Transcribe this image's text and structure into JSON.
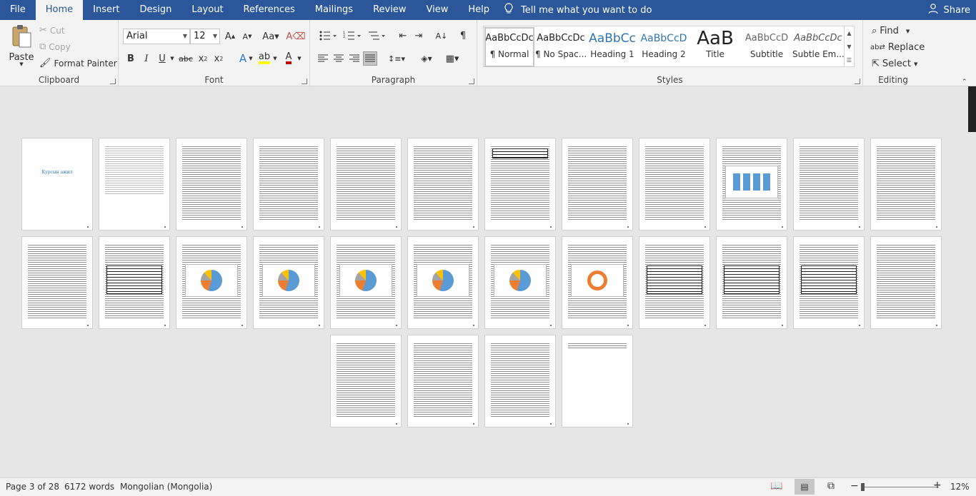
{
  "tabs": [
    "File",
    "Home",
    "Insert",
    "Design",
    "Layout",
    "References",
    "Mailings",
    "Review",
    "View",
    "Help"
  ],
  "tell_me": "Tell me what you want to do",
  "share": "Share",
  "clipboard": {
    "paste": "Paste",
    "cut": "Cut",
    "copy": "Copy",
    "format_painter": "Format Painter",
    "label": "Clipboard"
  },
  "font": {
    "name": "Arial",
    "size": "12",
    "label": "Font"
  },
  "paragraph": {
    "label": "Paragraph"
  },
  "styles": {
    "label": "Styles",
    "items": [
      {
        "preview": "AaBbCcDc",
        "name": "¶ Normal"
      },
      {
        "preview": "AaBbCcDc",
        "name": "¶ No Spac..."
      },
      {
        "preview": "AaBbCc",
        "name": "Heading 1"
      },
      {
        "preview": "AaBbCcD",
        "name": "Heading 2"
      },
      {
        "preview": "AaB",
        "name": "Title"
      },
      {
        "preview": "AaBbCcD",
        "name": "Subtitle"
      },
      {
        "preview": "AaBbCcDc",
        "name": "Subtle Em..."
      }
    ]
  },
  "editing": {
    "find": "Find",
    "replace": "Replace",
    "select": "Select",
    "label": "Editing"
  },
  "document": {
    "cover_title": "Курсын ажил"
  },
  "status": {
    "page": "Page 3 of 28",
    "words": "6172 words",
    "language": "Mongolian (Mongolia)",
    "zoom": "12%"
  },
  "colors": {
    "accent": "#2b579a",
    "font_color": "#c00000",
    "highlight": "#ffff00"
  }
}
